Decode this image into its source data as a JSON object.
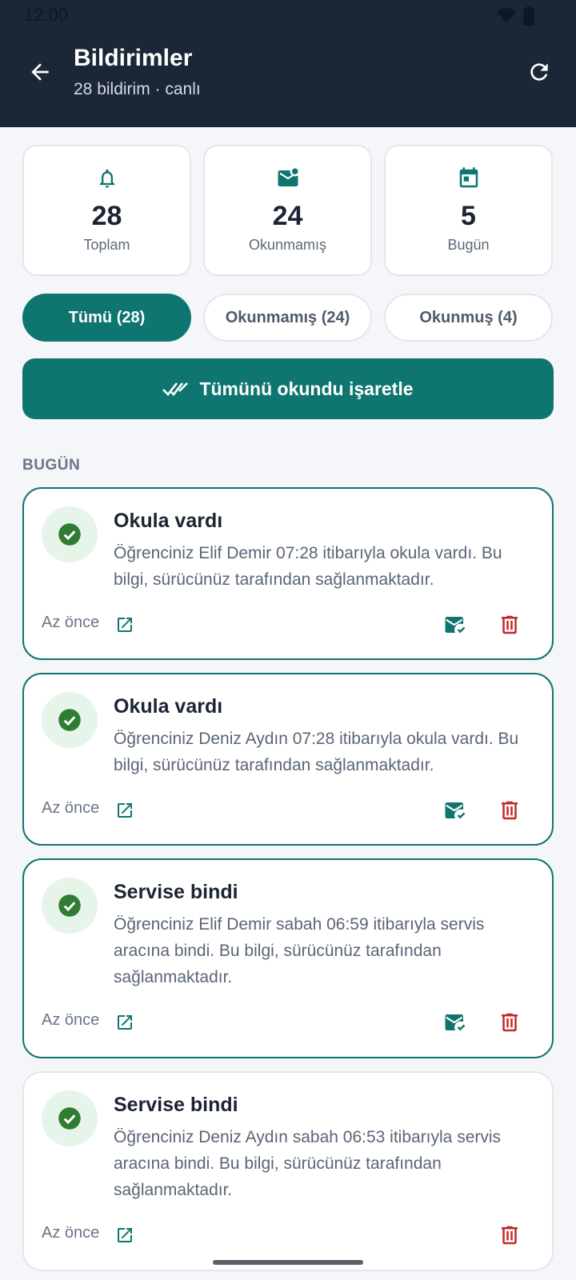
{
  "status_bar": {
    "time": "12:00"
  },
  "header": {
    "title": "Bildirimler",
    "subtitle": "28 bildirim · canlı"
  },
  "stats": [
    {
      "icon": "bell-icon",
      "value": "28",
      "label": "Toplam"
    },
    {
      "icon": "mail-unread-icon",
      "value": "24",
      "label": "Okunmamış"
    },
    {
      "icon": "calendar-icon",
      "value": "5",
      "label": "Bugün"
    }
  ],
  "filters": [
    {
      "label": "Tümü (28)",
      "active": true
    },
    {
      "label": "Okunmamış (24)",
      "active": false
    },
    {
      "label": "Okunmuş (4)",
      "active": false
    }
  ],
  "mark_all_label": "Tümünü okundu işaretle",
  "section": "BUGÜN",
  "notifications": [
    {
      "title": "Okula vardı",
      "body": "Öğrenciniz Elif Demir 07:28 itibarıyla okula vardı. Bu bilgi, sürücünüz tarafından sağlanmaktadır.",
      "time": "Az önce",
      "unread": true
    },
    {
      "title": "Okula vardı",
      "body": "Öğrenciniz Deniz Aydın 07:28 itibarıyla okula vardı. Bu bilgi, sürücünüz tarafından sağlanmaktadır.",
      "time": "Az önce",
      "unread": true
    },
    {
      "title": "Servise bindi",
      "body": "Öğrenciniz Elif Demir sabah 06:59 itibarıyla servis aracına bindi. Bu bilgi, sürücünüz tarafından sağlanmaktadır.",
      "time": "Az önce",
      "unread": true
    },
    {
      "title": "Servise bindi",
      "body": "Öğrenciniz Deniz Aydın sabah 06:53 itibarıyla servis aracına bindi. Bu bilgi, sürücünüz tarafından sağlanmaktadır.",
      "time": "Az önce",
      "unread": false
    }
  ],
  "colors": {
    "header_bg": "#1b2636",
    "accent": "#0e7570",
    "success": "#2e7d32",
    "danger": "#c62828"
  }
}
